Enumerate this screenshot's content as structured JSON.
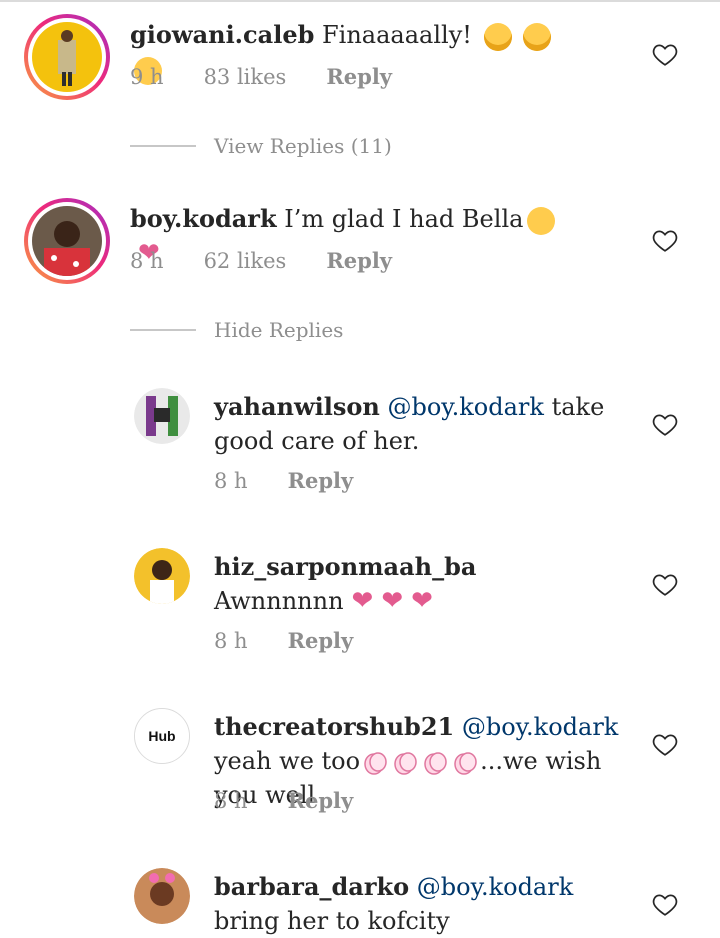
{
  "comments": [
    {
      "username": "giowani.caleb",
      "text": "Finaaaaally!",
      "emoji": [
        "laugh",
        "laugh",
        "love"
      ],
      "time": "9 h",
      "likes": "83 likes",
      "reply_label": "Reply"
    },
    {
      "username": "boy.kodark",
      "text": "I’m glad I had Bella",
      "emoji": [
        "hug",
        "pink-heart"
      ],
      "time": "8 h",
      "likes": "62 likes",
      "reply_label": "Reply"
    }
  ],
  "toggles": {
    "view_replies": "View Replies (11)",
    "hide_replies": "Hide Replies"
  },
  "replies": [
    {
      "username": "yahanwilson",
      "mention": "@boy.kodark",
      "text": " take good care of her.",
      "time": "8 h",
      "reply_label": "Reply"
    },
    {
      "username": "hiz_sarponmaah_ba",
      "text": "Awnnnnnn",
      "hearts": 3,
      "time": "8 h",
      "reply_label": "Reply"
    },
    {
      "username": "thecreatorshub21",
      "mention": "@boy.kodark",
      "text_before": " yeah we too",
      "text_after": "...we wish you well",
      "claps": 4,
      "time": "8 h",
      "reply_label": "Reply"
    },
    {
      "username": "barbara_darko",
      "mention": "@boy.kodark",
      "text": " bring her to kofcity"
    }
  ],
  "avatar_labels": {
    "hub": "Hub"
  },
  "colors": {
    "mention": "#00376b",
    "meta": "#8e8e8e",
    "pink_heart": "#e35b8f"
  }
}
